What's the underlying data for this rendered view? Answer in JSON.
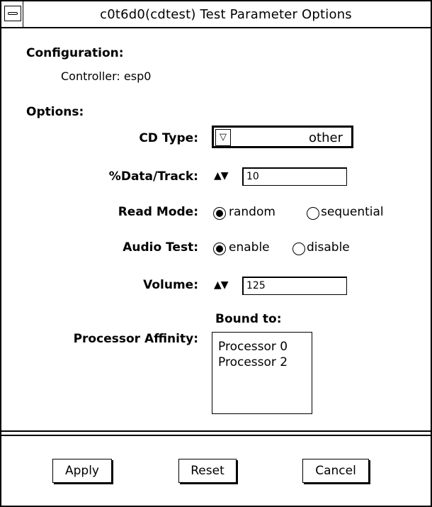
{
  "window": {
    "title": "c0t6d0(cdtest) Test Parameter Options"
  },
  "configuration": {
    "heading": "Configuration:",
    "controller": "Controller: esp0"
  },
  "options": {
    "heading": "Options:",
    "cd_type": {
      "label": "CD Type:",
      "value": "other"
    },
    "data_track": {
      "label": "%Data/Track:",
      "value": "10"
    },
    "read_mode": {
      "label": "Read Mode:",
      "options": [
        "random",
        "sequential"
      ],
      "selected": "random"
    },
    "audio_test": {
      "label": "Audio Test:",
      "options": [
        "enable",
        "disable"
      ],
      "selected": "enable"
    },
    "volume": {
      "label": "Volume:",
      "value": "125"
    },
    "processor_affinity": {
      "label": "Processor Affinity:",
      "bound_to_label": "Bound to:",
      "items": [
        "Processor 0",
        "Processor 2"
      ]
    }
  },
  "buttons": {
    "apply": "Apply",
    "reset": "Reset",
    "cancel": "Cancel"
  },
  "icons": {
    "window_menu": "window-menu-icon",
    "dropdown": "triangle-down-icon",
    "spin": "up-down-arrows-icon"
  }
}
